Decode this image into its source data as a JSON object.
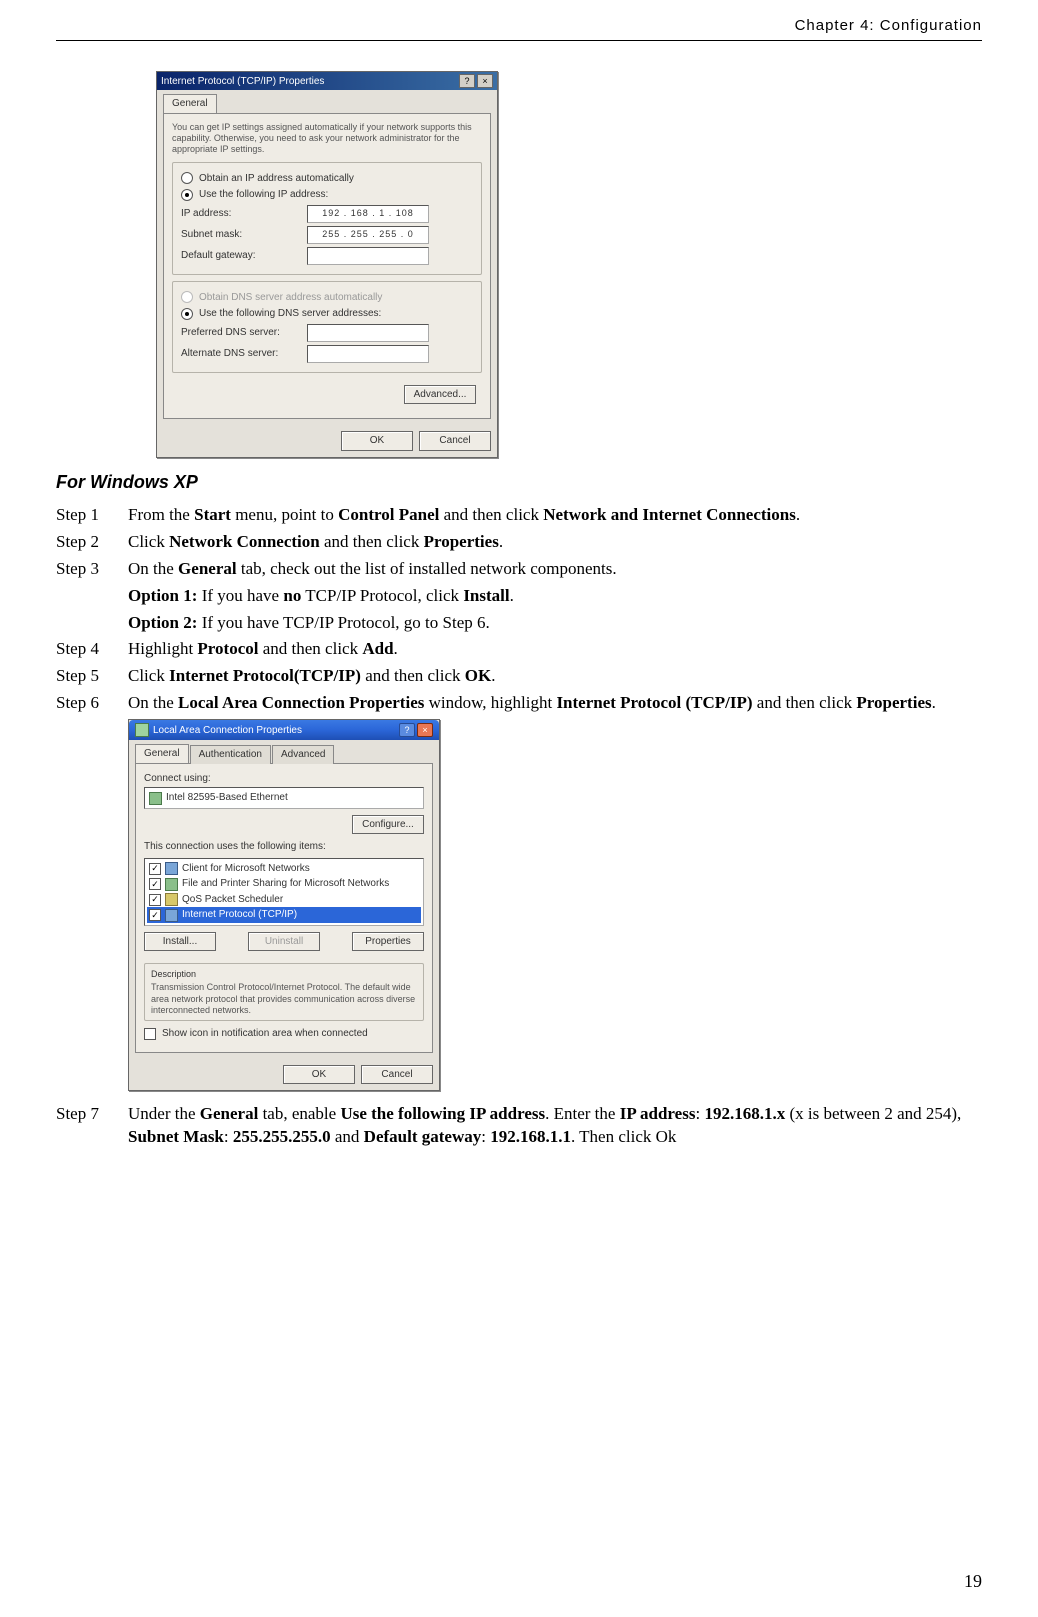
{
  "header": {
    "chapter": "Chapter 4: Configuration"
  },
  "page_number": "19",
  "dialog1": {
    "title": "Internet Protocol (TCP/IP) Properties",
    "tab_general": "General",
    "desc": "You can get IP settings assigned automatically if your network supports this capability. Otherwise, you need to ask your network administrator for the appropriate IP settings.",
    "radio_auto": "Obtain an IP address automatically",
    "radio_use": "Use the following IP address:",
    "lbl_ip": "IP address:",
    "val_ip": "192 . 168 .  1  . 108",
    "lbl_mask": "Subnet mask:",
    "val_mask": "255 . 255 . 255 .  0",
    "lbl_gw": "Default gateway:",
    "val_gw": "",
    "radio_dns_auto": "Obtain DNS server address automatically",
    "radio_dns_use": "Use the following DNS server addresses:",
    "lbl_pdns": "Preferred DNS server:",
    "lbl_adns": "Alternate DNS server:",
    "btn_adv": "Advanced...",
    "btn_ok": "OK",
    "btn_cancel": "Cancel"
  },
  "section_title": "For Windows XP",
  "steps": {
    "s1": {
      "label": "Step 1",
      "text_a": "From the ",
      "b1": "Start",
      "text_b": " menu, point to ",
      "b2": "Control Panel",
      "text_c": " and then click ",
      "b3": "Network and Internet    Connections",
      "text_d": "."
    },
    "s2": {
      "label": "Step 2",
      "text_a": "Click ",
      "b1": "Network Connection",
      "text_b": " and then click ",
      "b2": "Properties",
      "text_c": "."
    },
    "s3": {
      "label": "Step 3",
      "text_a": "On the ",
      "b1": "General",
      "text_b": " tab, check out the list of installed network components."
    },
    "s3_opt1": {
      "b1": "Option 1:",
      "text_a": " If you have ",
      "b2": "no",
      "text_b": " TCP/IP Protocol, click ",
      "b3": "Install",
      "text_c": "."
    },
    "s3_opt2": {
      "b1": "Option 2:",
      "text_a": " If you have TCP/IP Protocol, go to Step 6."
    },
    "s4": {
      "label": "Step 4",
      "text_a": "Highlight ",
      "b1": "Protocol",
      "text_b": " and then click ",
      "b2": "Add",
      "text_c": "."
    },
    "s5": {
      "label": "Step 5",
      "text_a": "Click ",
      "b1": "Internet Protocol(TCP/IP)",
      "text_b": " and then click ",
      "b2": "OK",
      "text_c": "."
    },
    "s6": {
      "label": "Step 6",
      "text_a": "On the ",
      "b1": "Local Area Connection Properties",
      "text_b": " window, highlight ",
      "b2": "Internet Protocol (TCP/IP)",
      "text_c": " and then click ",
      "b3": "Properties",
      "text_d": "."
    },
    "s7": {
      "label": "Step 7",
      "text_a": "Under the ",
      "b1": "General",
      "text_b": " tab, enable ",
      "b2": "Use the following IP address",
      "text_c": ". Enter the ",
      "b3": "IP address",
      "text_d": ": ",
      "b4": "192.168.1.x",
      "text_e": " (x is between 2 and 254), ",
      "b5": "Subnet Mask",
      "text_f": ": ",
      "b6": "255.255.255.0",
      "text_g": " and ",
      "b7": "Default gateway",
      "text_h": ": ",
      "b8": "192.168.1.1",
      "text_i": ". Then click Ok"
    }
  },
  "dialog2": {
    "title": "Local Area Connection Properties",
    "tab_general": "General",
    "tab_auth": "Authentication",
    "tab_adv": "Advanced",
    "lbl_connect": "Connect using:",
    "adapter": "Intel 82595-Based Ethernet",
    "btn_config": "Configure...",
    "lbl_items": "This connection uses the following items:",
    "item1": "Client for Microsoft Networks",
    "item2": "File and Printer Sharing for Microsoft Networks",
    "item3": "QoS Packet Scheduler",
    "item4": "Internet Protocol (TCP/IP)",
    "btn_install": "Install...",
    "btn_uninstall": "Uninstall",
    "btn_props": "Properties",
    "lbl_desc": "Description",
    "desc_text": "Transmission Control Protocol/Internet Protocol. The default wide area network protocol that provides communication across diverse interconnected networks.",
    "chk_showicon": "Show icon in notification area when connected",
    "btn_ok": "OK",
    "btn_cancel": "Cancel"
  }
}
